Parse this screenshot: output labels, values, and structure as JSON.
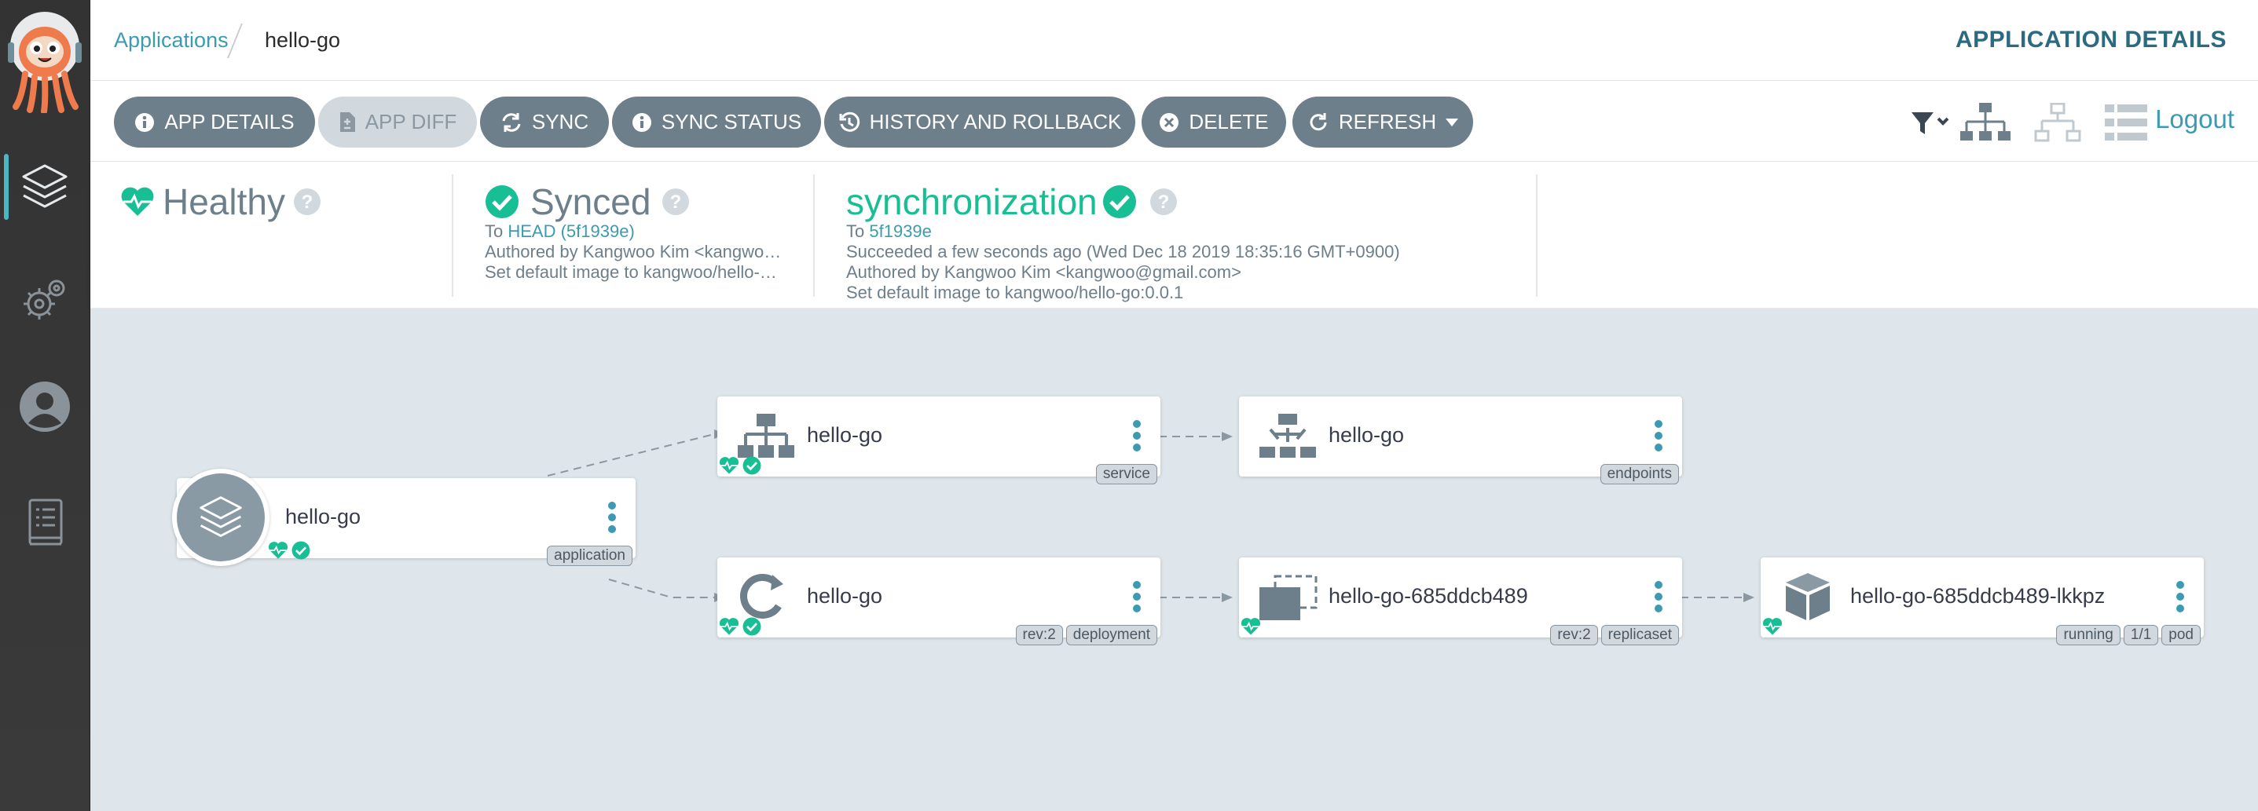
{
  "breadcrumb": {
    "root": "Applications",
    "current": "hello-go"
  },
  "page_heading": "APPLICATION DETAILS",
  "toolbar": {
    "buttons": [
      {
        "label": "APP DETAILS",
        "icon": "info-icon"
      },
      {
        "label": "APP DIFF",
        "icon": "file-diff-icon",
        "disabled": true
      },
      {
        "label": "SYNC",
        "icon": "sync-icon"
      },
      {
        "label": "SYNC STATUS",
        "icon": "info-icon"
      },
      {
        "label": "HISTORY AND ROLLBACK",
        "icon": "history-icon"
      },
      {
        "label": "DELETE",
        "icon": "close-circle-icon"
      },
      {
        "label": "REFRESH",
        "icon": "refresh-icon"
      }
    ],
    "logout": "Logout"
  },
  "status": {
    "health": {
      "label": "Healthy",
      "color": "#18be94"
    },
    "sync": {
      "label": "Synced",
      "to_prefix": "To",
      "revision": "HEAD (5f1939e)",
      "author": "Authored by Kangwoo Kim <kangwo…",
      "message": "Set default image to kangwoo/hello-…"
    },
    "operation": {
      "label": "synchronization",
      "to_prefix": "To",
      "revision": "5f1939e",
      "result": "Succeeded a few seconds ago (Wed Dec 18 2019 18:35:16 GMT+0900)",
      "author": "Authored by Kangwoo Kim <kangwoo@gmail.com>",
      "message": "Set default image to kangwoo/hello-go:0.0.1"
    }
  },
  "graph": {
    "nodes": [
      {
        "name": "hello-go",
        "kind": "application",
        "tags": [
          "application"
        ]
      },
      {
        "name": "hello-go",
        "kind": "service",
        "tags": [
          "service"
        ]
      },
      {
        "name": "hello-go",
        "kind": "endpoints",
        "tags": [
          "endpoints"
        ]
      },
      {
        "name": "hello-go",
        "kind": "deployment",
        "tags": [
          "rev:2",
          "deployment"
        ]
      },
      {
        "name": "hello-go-685ddcb489",
        "kind": "replicaset",
        "tags": [
          "rev:2",
          "replicaset"
        ]
      },
      {
        "name": "hello-go-685ddcb489-lkkpz",
        "kind": "pod",
        "tags": [
          "running",
          "1/1",
          "pod"
        ]
      }
    ]
  },
  "colors": {
    "accent": "#3c9bb0",
    "button": "#6d7f8b",
    "healthy": "#18be94",
    "canvas": "#dee6eb"
  }
}
